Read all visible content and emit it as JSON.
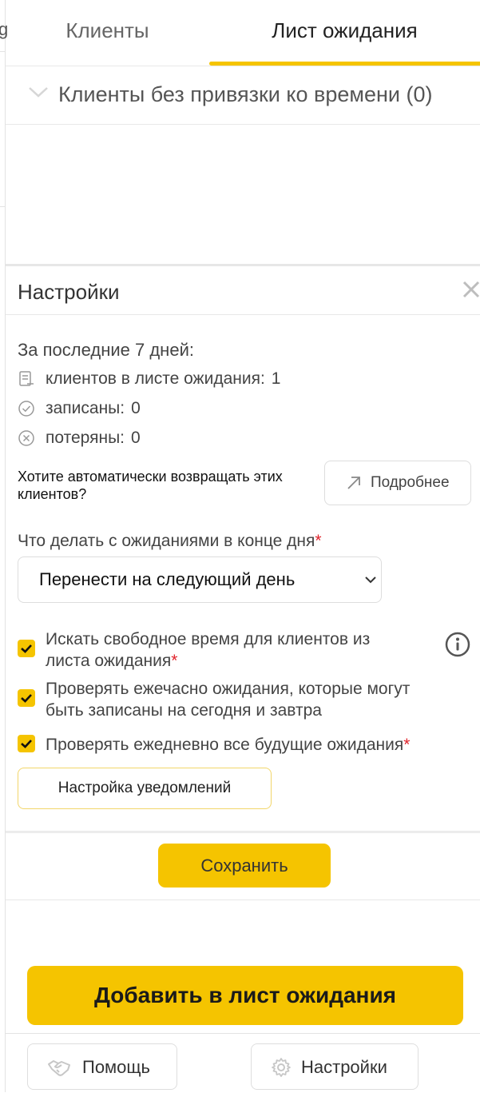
{
  "edge_fragment": "g",
  "tabs": [
    {
      "label": "Клиенты",
      "active": false
    },
    {
      "label": "Лист ожидания",
      "active": true
    }
  ],
  "accent_color": "#f5c400",
  "group": {
    "title": "Клиенты без привязки ко времени (0)",
    "icon": "chevron-down-icon"
  },
  "settings": {
    "title": "Настройки",
    "close_icon": "close-icon",
    "stats_heading": "За последние 7 дней:",
    "stats": [
      {
        "label": "клиентов в листе ожидания:",
        "value": "1",
        "icon": "list-icon"
      },
      {
        "label": "записаны:",
        "value": "0",
        "icon": "check-circle-icon"
      },
      {
        "label": "потеряны:",
        "value": "0",
        "icon": "x-circle-icon"
      }
    ],
    "auto_question": "Хотите автоматически возвращать этих клиентов?",
    "more_button": "Подробнее",
    "end_of_day_label": "Что делать с ожиданиями в конце дня",
    "required_mark": "*",
    "end_of_day_value": "Перенести на следующий день",
    "checkboxes": [
      {
        "line1": "Искать свободное время для клиентов из",
        "line2": "листа ожидания",
        "checked": true,
        "required": true
      },
      {
        "line1": "Проверять ежечасно ожидания, которые могут",
        "line2": "быть записаны на сегодня и завтра",
        "checked": true,
        "required": false
      },
      {
        "line1": "Проверять ежедневно все будущие ожидания",
        "checked": true,
        "required": true
      }
    ],
    "notifications_button": "Настройка уведомлений",
    "save_button": "Сохранить"
  },
  "add_button": "Добавить в лист ожидания",
  "footer": {
    "help": "Помощь",
    "settings": "Настройки"
  }
}
